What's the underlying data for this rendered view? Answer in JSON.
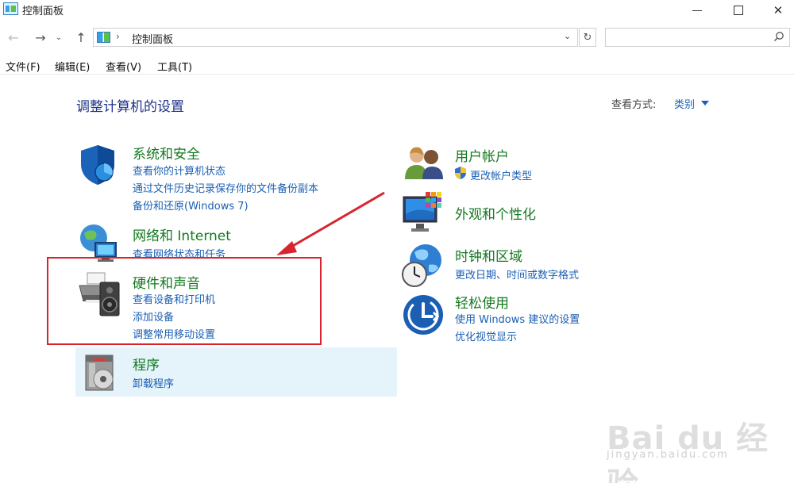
{
  "window": {
    "title": "控制面板",
    "close_glyph": "✕"
  },
  "nav": {
    "back_glyph": "←",
    "forward_glyph": "→",
    "recent_glyph": "⌄",
    "up_glyph": "↑",
    "address_separator": "›",
    "address_path": "控制面板",
    "address_dropdown": "⌄",
    "refresh_glyph": "↻",
    "search_placeholder": ""
  },
  "menu": {
    "items": [
      {
        "label": "文件(F)"
      },
      {
        "label": "编辑(E)"
      },
      {
        "label": "查看(V)"
      },
      {
        "label": "工具(T)"
      }
    ]
  },
  "content": {
    "title": "调整计算机的设置",
    "view_by_label": "查看方式:",
    "view_by_value": "类别"
  },
  "categories": [
    {
      "id": "system-security",
      "title": "系统和安全",
      "icon": "shield-icon",
      "links": [
        "查看你的计算机状态",
        "通过文件历史记录保存你的文件备份副本",
        "备份和还原(Windows 7)"
      ]
    },
    {
      "id": "network-internet",
      "title": "网络和 Internet",
      "icon": "globe-network-icon",
      "links": [
        "查看网络状态和任务"
      ]
    },
    {
      "id": "hardware-sound",
      "title": "硬件和声音",
      "icon": "printer-speaker-icon",
      "links": [
        "查看设备和打印机",
        "添加设备",
        "调整常用移动设置"
      ]
    },
    {
      "id": "programs",
      "title": "程序",
      "icon": "programs-disc-icon",
      "links": [
        "卸载程序"
      ]
    },
    {
      "id": "user-accounts",
      "title": "用户帐户",
      "icon": "users-icon",
      "links": [
        "更改帐户类型"
      ],
      "link_icon": "uac-shield-icon"
    },
    {
      "id": "appearance",
      "title": "外观和个性化",
      "icon": "monitor-palette-icon",
      "links": []
    },
    {
      "id": "clock-region",
      "title": "时钟和区域",
      "icon": "clock-globe-icon",
      "links": [
        "更改日期、时间或数字格式"
      ]
    },
    {
      "id": "ease-of-access",
      "title": "轻松使用",
      "icon": "ease-of-access-icon",
      "links": [
        "使用 Windows 建议的设置",
        "优化视觉显示"
      ]
    }
  ],
  "annotation": {
    "color": "#d8242e"
  },
  "watermark": {
    "logo": "Bai du 经验",
    "url": "jingyan.baidu.com"
  },
  "colors": {
    "category_title": "#13791f",
    "link": "#1a5fb4",
    "page_title": "#1e3287",
    "programs_highlight": "#e5f3fb"
  }
}
